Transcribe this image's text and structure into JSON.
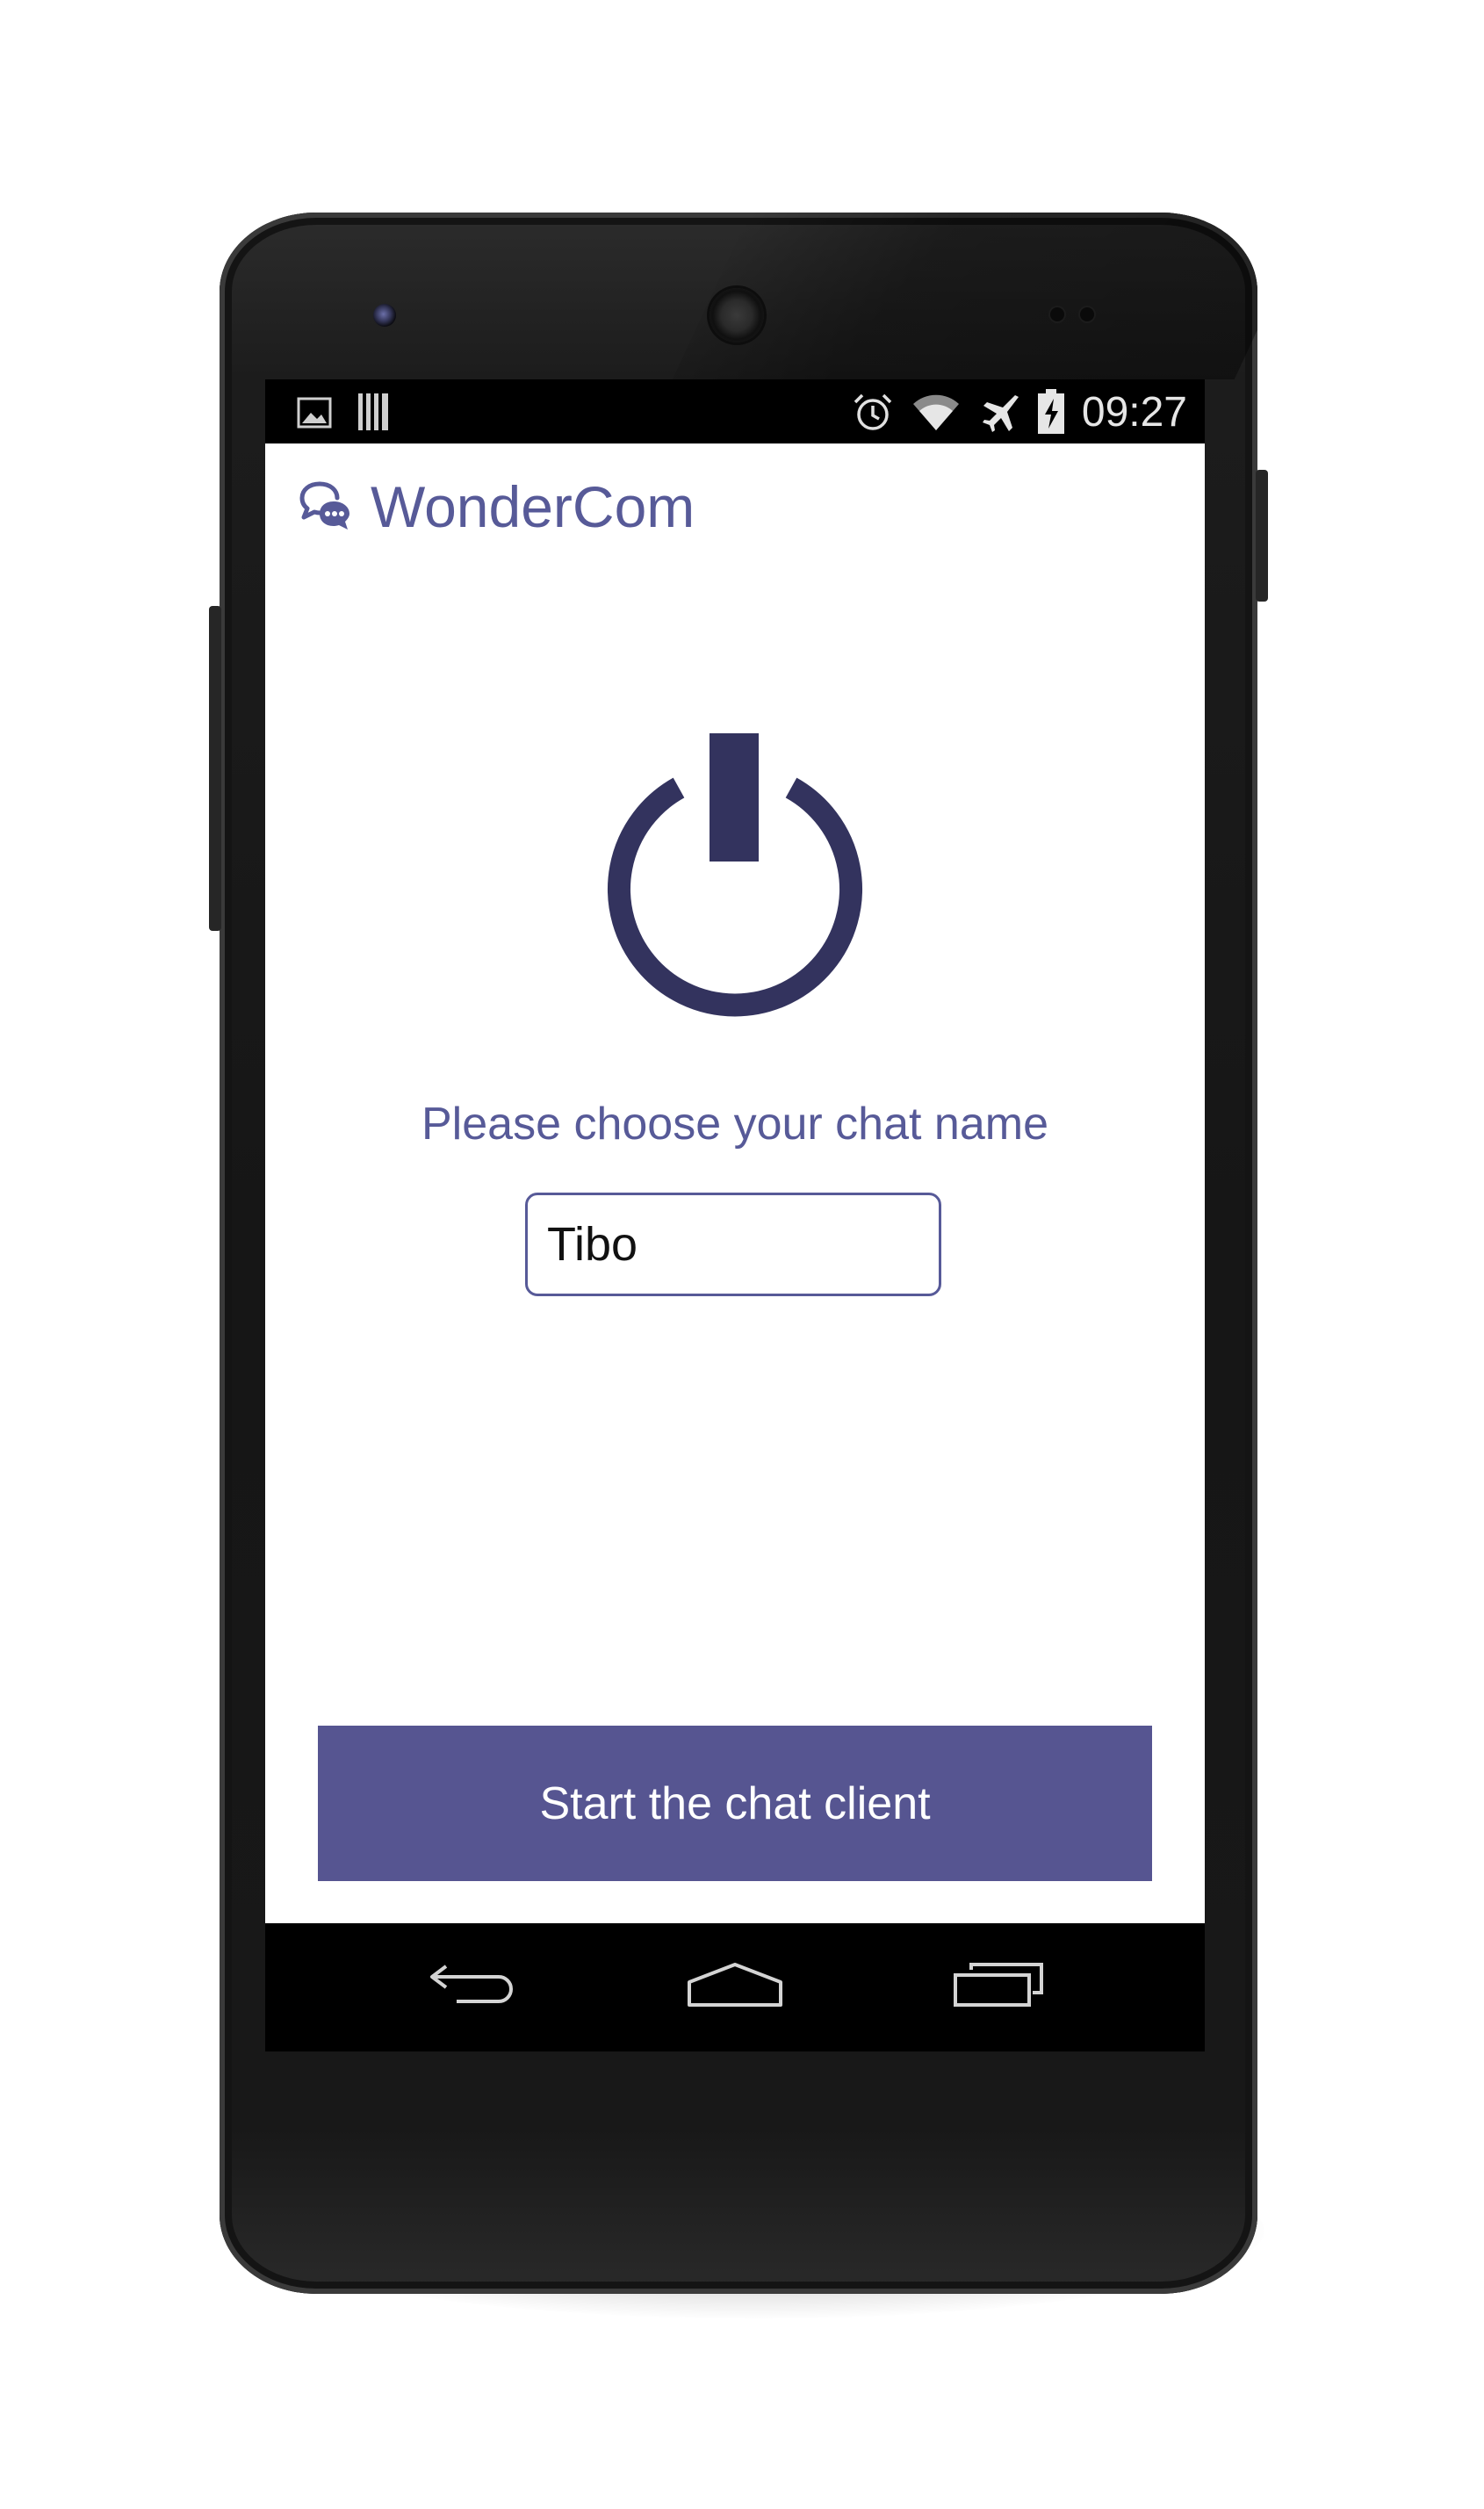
{
  "status_bar": {
    "time": "09:27",
    "icons": [
      "image-notification-icon",
      "barcode-notification-icon",
      "alarm-icon",
      "wifi-icon",
      "airplane-mode-icon",
      "battery-charging-icon"
    ]
  },
  "app": {
    "title": "WonderCom",
    "logo_icon": "chat-bubbles-icon"
  },
  "main": {
    "power_icon": "power-icon",
    "prompt": "Please choose your chat name",
    "name_input": {
      "value": "Tibo"
    },
    "start_button_label": "Start the chat client"
  },
  "nav_bar": {
    "buttons": [
      "back-icon",
      "home-icon",
      "recent-apps-icon"
    ]
  },
  "colors": {
    "accent": "#575a98",
    "button": "#565591",
    "power_icon": "#33335e"
  }
}
